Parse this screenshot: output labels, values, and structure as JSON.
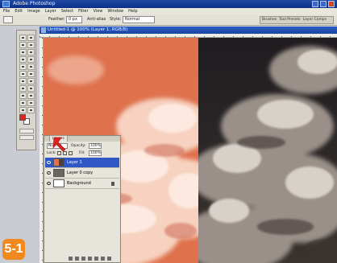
{
  "app": {
    "title": "Adobe Photoshop",
    "menu": [
      "File",
      "Edit",
      "Image",
      "Layer",
      "Select",
      "Filter",
      "View",
      "Window",
      "Help"
    ]
  },
  "options_bar": {
    "feather_label": "Feather:",
    "feather_value": "0 px",
    "antialias_label": "Anti-alias",
    "style_label": "Style:",
    "style_value": "Normal",
    "palette_tabs": [
      "Brushes",
      "Tool Presets",
      "Layer Comps"
    ]
  },
  "document": {
    "title": "Untitled-1 @ 100% (Layer 1, RGB/8)"
  },
  "toolbox": {
    "foreground_color": "#e8221c",
    "background_color": "#ffffff"
  },
  "layers_panel": {
    "tab_label": "Layers",
    "blend_mode": "Normal",
    "opacity_label": "Opacity:",
    "opacity_value": "100%",
    "lock_label": "Lock:",
    "fill_label": "Fill:",
    "fill_value": "100%",
    "layers": [
      {
        "name": "Layer 1",
        "selected": true,
        "locked": false
      },
      {
        "name": "Layer 0 copy",
        "selected": false,
        "locked": false
      },
      {
        "name": "Background",
        "selected": false,
        "locked": true
      }
    ]
  },
  "colors": {
    "orange_tint": "#e2734f",
    "pointer_arrow": "#e02020",
    "badge": "#f08a1e",
    "selected_layer": "#2f58c6"
  },
  "icons": [
    "photoshop-app-icon",
    "red-arrow-icon",
    "eye-icon",
    "lock-icon",
    "link-icon"
  ],
  "badge_label": "5-1"
}
